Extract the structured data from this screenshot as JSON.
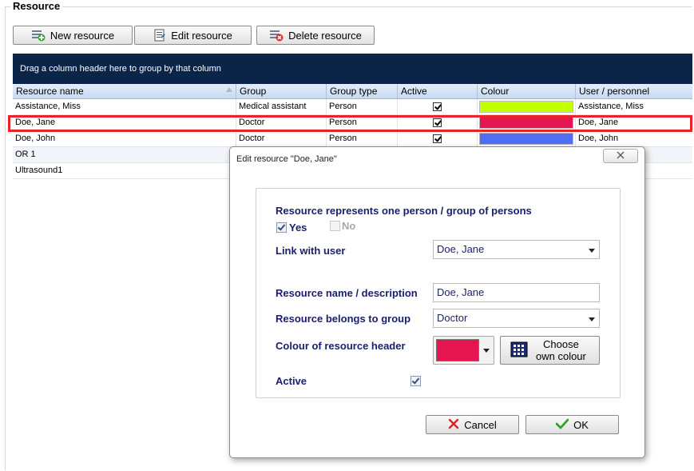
{
  "section": {
    "title": "Resource"
  },
  "toolbar": {
    "new_label": "New resource",
    "edit_label": "Edit resource",
    "delete_label": "Delete resource"
  },
  "grid": {
    "group_hint": "Drag a column header here to group by that column",
    "columns": [
      "Resource name",
      "Group",
      "Group type",
      "Active",
      "Colour",
      "User / personnel"
    ],
    "rows": [
      {
        "name": "Assistance, Miss",
        "group": "Medical assistant",
        "type": "Person",
        "active": true,
        "colour": "#c2ff00",
        "user": "Assistance, Miss"
      },
      {
        "name": "Doe, Jane",
        "group": "Doctor",
        "type": "Person",
        "active": true,
        "colour": "#e5164f",
        "user": "Doe, Jane"
      },
      {
        "name": "Doe, John",
        "group": "Doctor",
        "type": "Person",
        "active": true,
        "colour": "#4d6ef5",
        "user": "Doe, John"
      },
      {
        "name": "OR 1",
        "group": "",
        "type": "",
        "active": null,
        "colour": "",
        "user": ""
      },
      {
        "name": "Ultrasound1",
        "group": "",
        "type": "",
        "active": null,
        "colour": "",
        "user": ""
      }
    ]
  },
  "dialog": {
    "title": "Edit resource \"Doe, Jane\"",
    "represents_label": "Resource represents one person / group of persons",
    "yes_label": "Yes",
    "no_label": "No",
    "link_user_label": "Link with user",
    "link_user_value": "Doe, Jane",
    "name_label": "Resource name / description",
    "name_value": "Doe, Jane",
    "group_label": "Resource belongs to group",
    "group_value": "Doctor",
    "colour_label": "Colour of resource header",
    "colour_value": "#e5164f",
    "choose_colour_line1": "Choose",
    "choose_colour_line2": "own colour",
    "active_label": "Active",
    "cancel_label": "Cancel",
    "ok_label": "OK"
  },
  "colors": {
    "group_panel": "#0a2548",
    "highlight": "#e8242a",
    "label_text": "#1a1f6b"
  }
}
